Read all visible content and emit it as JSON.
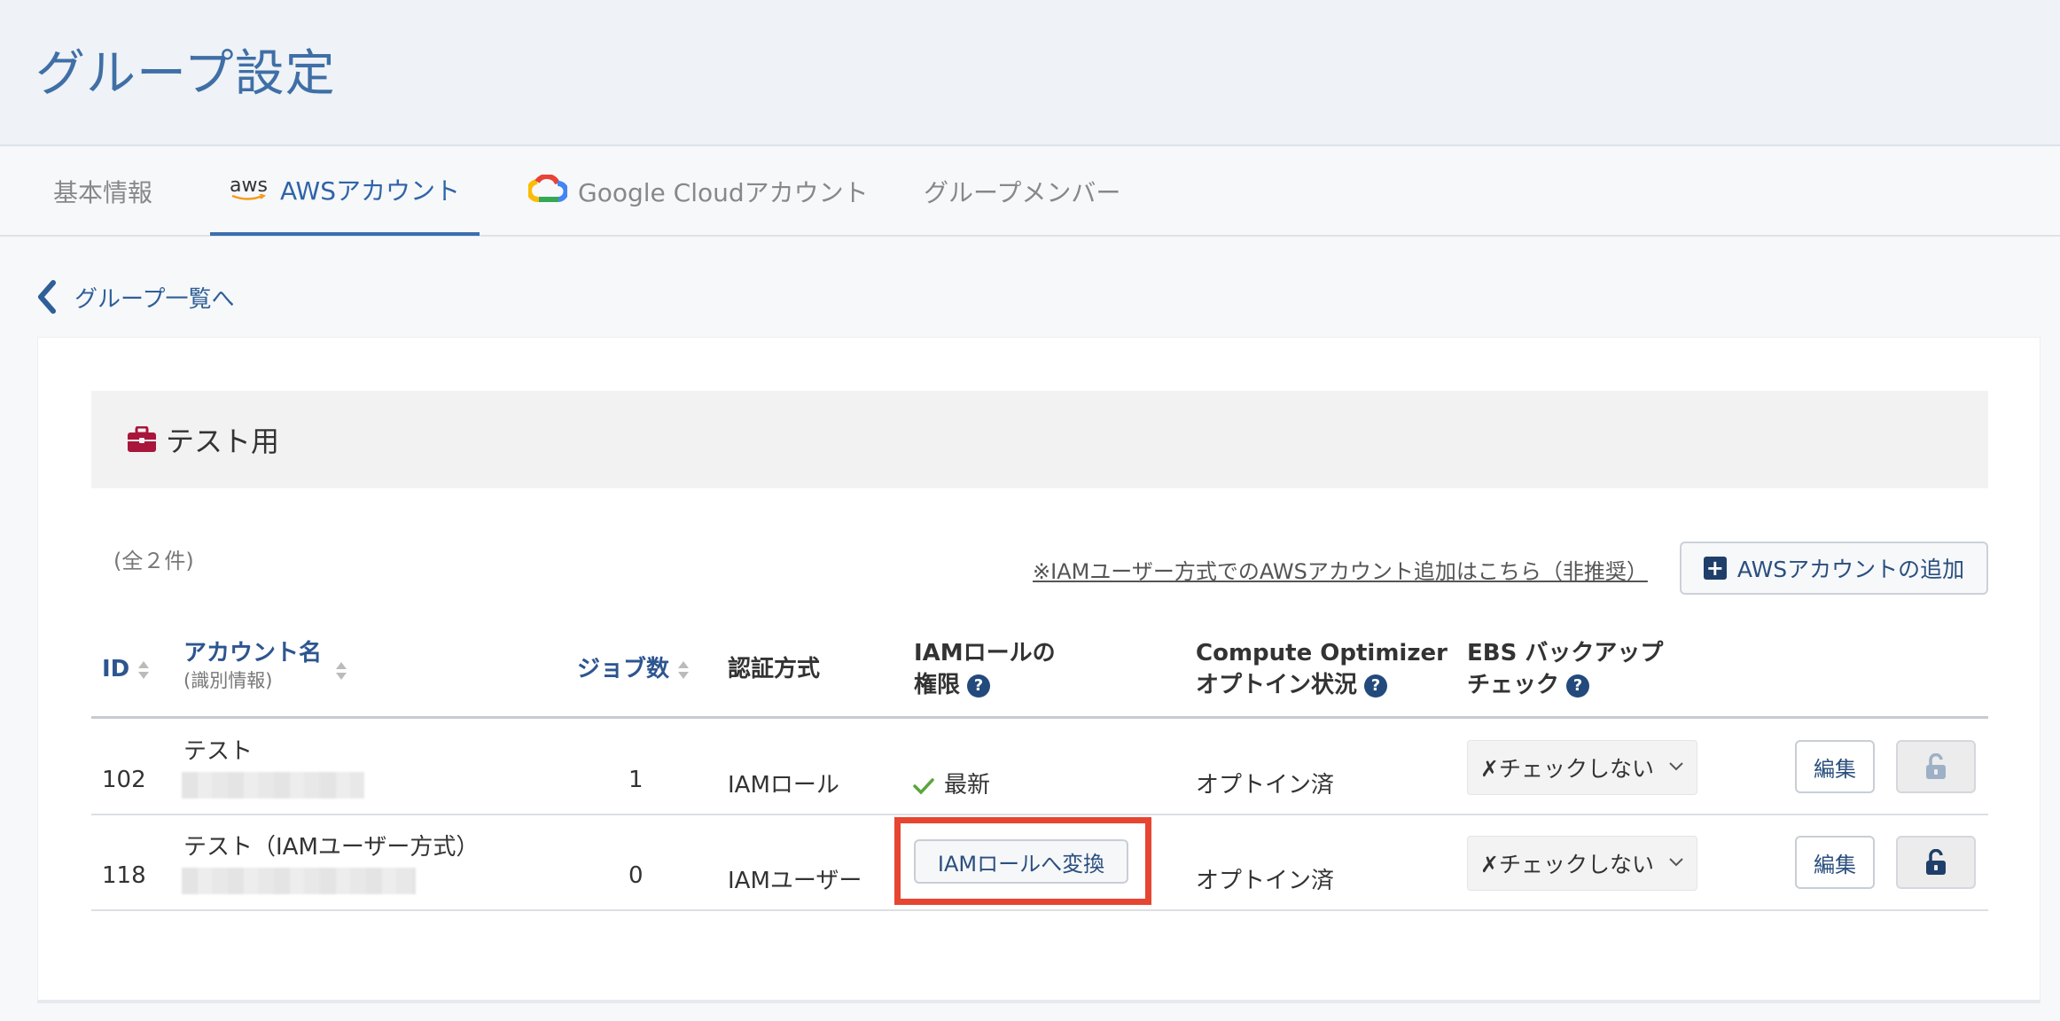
{
  "page": {
    "title": "グループ設定"
  },
  "tabs": [
    {
      "label": "基本情報",
      "active": false
    },
    {
      "label": "AWSアカウント",
      "active": true,
      "icon": "aws-logo"
    },
    {
      "label": "Google Cloudアカウント",
      "active": false,
      "icon": "google-cloud-icon"
    },
    {
      "label": "グループメンバー",
      "active": false
    }
  ],
  "aws_logo_text": "aws",
  "back_link": {
    "label": "グループ一覧へ"
  },
  "group": {
    "name": "テスト用",
    "icon": "briefcase-icon"
  },
  "list": {
    "count_text": "(全２件)",
    "legacy_link": "※IAMユーザー方式でのAWSアカウント追加はこちら（非推奨）",
    "add_button": "AWSアカウントの追加"
  },
  "table": {
    "headers": {
      "id": "ID",
      "account_name": "アカウント名",
      "account_name_sub": "(識別情報)",
      "jobs": "ジョブ数",
      "auth": "認証方式",
      "iam_role_line1": "IAMロールの",
      "iam_role_line2": "権限",
      "co_line1": "Compute Optimizer",
      "co_line2": "オプトイン状況",
      "ebs_line1": "EBS バックアップ",
      "ebs_line2": "チェック"
    },
    "rows": [
      {
        "id": "102",
        "name": "テスト",
        "jobs": "1",
        "auth": "IAMロール",
        "iam_status": "最新",
        "optin": "オプトイン済",
        "ebs_check": "✗チェックしない",
        "edit": "編集",
        "locked": false
      },
      {
        "id": "118",
        "name": "テスト（IAMユーザー方式）",
        "jobs": "0",
        "auth": "IAMユーザー",
        "convert_button": "IAMロールへ変換",
        "optin": "オプトイン済",
        "ebs_check": "✗チェックしない",
        "edit": "編集",
        "locked": true
      }
    ]
  },
  "colors": {
    "accent": "#2f64a8",
    "highlight": "#e64531",
    "check": "#5aa63a",
    "briefcase": "#a8163b"
  }
}
